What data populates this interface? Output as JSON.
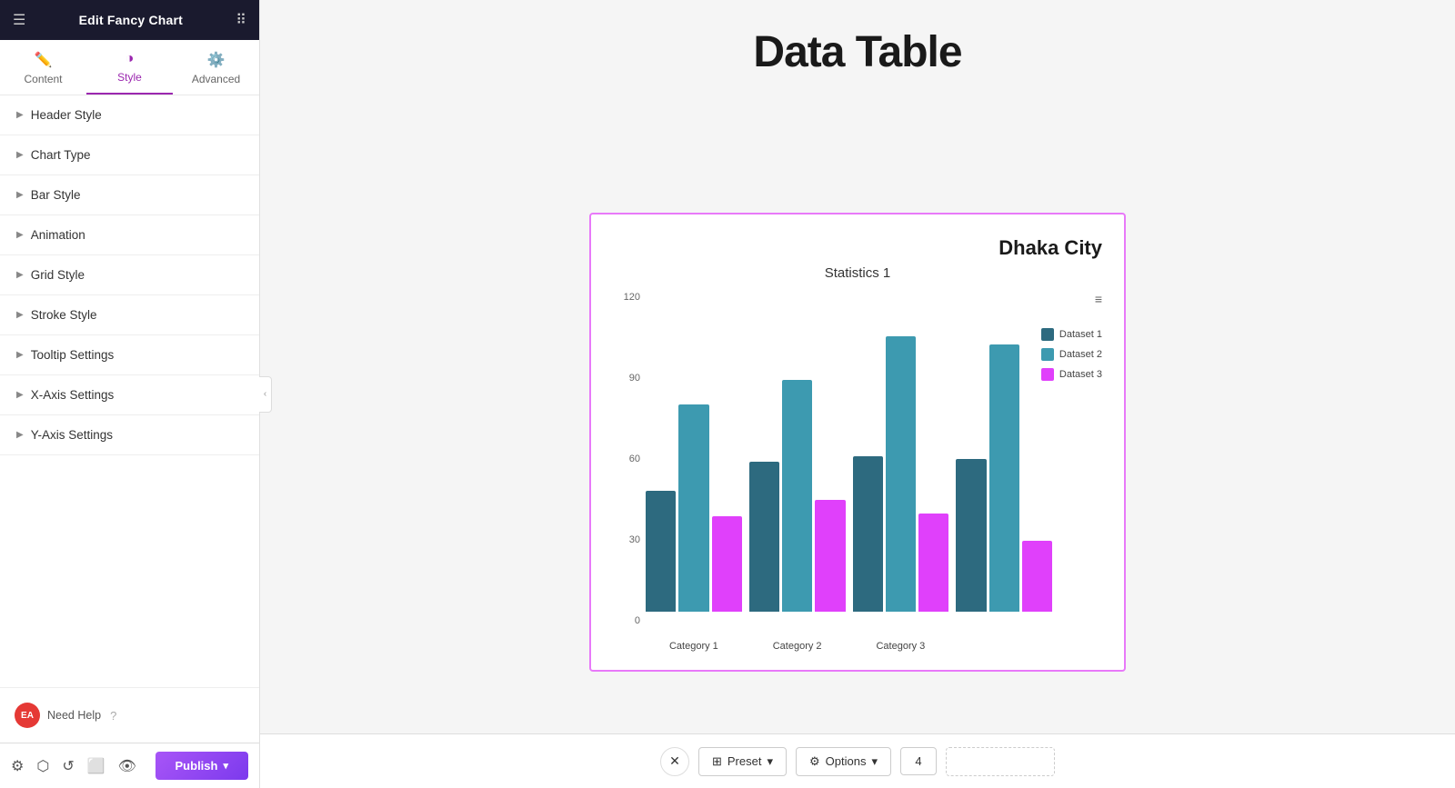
{
  "sidebar": {
    "header": {
      "title": "Edit Fancy Chart",
      "menu_icon": "☰",
      "grid_icon": "⠿"
    },
    "tabs": [
      {
        "id": "content",
        "label": "Content",
        "icon": "✏️"
      },
      {
        "id": "style",
        "label": "Style",
        "icon": "◑",
        "active": true
      },
      {
        "id": "advanced",
        "label": "Advanced",
        "icon": "⚙️"
      }
    ],
    "accordion_items": [
      {
        "label": "Header Style"
      },
      {
        "label": "Chart Type"
      },
      {
        "label": "Bar Style"
      },
      {
        "label": "Animation"
      },
      {
        "label": "Grid Style"
      },
      {
        "label": "Stroke Style"
      },
      {
        "label": "Tooltip Settings"
      },
      {
        "label": "X-Axis Settings"
      },
      {
        "label": "Y-Axis Settings"
      }
    ],
    "help": {
      "label": "Need Help",
      "avatar": "EA",
      "question_mark": "?"
    },
    "footer_icons": [
      "⚙",
      "⬡",
      "↺",
      "⬜",
      "👁"
    ],
    "publish_label": "Publish"
  },
  "main": {
    "page_title": "Data Table",
    "chart": {
      "city_label": "Dhaka City",
      "subtitle": "Statistics 1",
      "y_labels": [
        "120",
        "90",
        "60",
        "30",
        "0"
      ],
      "categories": [
        {
          "label": "Category 1",
          "bars": [
            {
              "dataset": 1,
              "value": 44,
              "height_pct": 37,
              "color": "d1"
            },
            {
              "dataset": 2,
              "value": 76,
              "height_pct": 63,
              "color": "d2"
            },
            {
              "dataset": 3,
              "value": 35,
              "height_pct": 29,
              "color": "d3"
            }
          ]
        },
        {
          "label": "Category 2",
          "bars": [
            {
              "dataset": 1,
              "value": 55,
              "height_pct": 46,
              "color": "d1"
            },
            {
              "dataset": 2,
              "value": 85,
              "height_pct": 71,
              "color": "d2"
            },
            {
              "dataset": 3,
              "value": 41,
              "height_pct": 34,
              "color": "d3"
            }
          ]
        },
        {
          "label": "Category 3",
          "bars": [
            {
              "dataset": 1,
              "value": 57,
              "height_pct": 48,
              "color": "d1"
            },
            {
              "dataset": 2,
              "value": 101,
              "height_pct": 84,
              "color": "d2"
            },
            {
              "dataset": 3,
              "value": 36,
              "height_pct": 30,
              "color": "d3"
            }
          ]
        },
        {
          "label": "",
          "bars": [
            {
              "dataset": 1,
              "value": 56,
              "height_pct": 47,
              "color": "d1"
            },
            {
              "dataset": 2,
              "value": 98,
              "height_pct": 82,
              "color": "d2"
            },
            {
              "dataset": 3,
              "value": 26,
              "height_pct": 22,
              "color": "d3"
            }
          ]
        }
      ],
      "legend": [
        {
          "label": "Dataset 1",
          "color": "#2d6a7f"
        },
        {
          "label": "Dataset 2",
          "color": "#3d9ab0"
        },
        {
          "label": "Dataset 3",
          "color": "#e040fb"
        }
      ]
    }
  },
  "bottom_bar": {
    "preset_label": "Preset",
    "options_label": "Options",
    "page_number": "4",
    "preset_icon": "⊞",
    "options_icon": "⚙",
    "chevron": "▾",
    "close_icon": "✕"
  }
}
